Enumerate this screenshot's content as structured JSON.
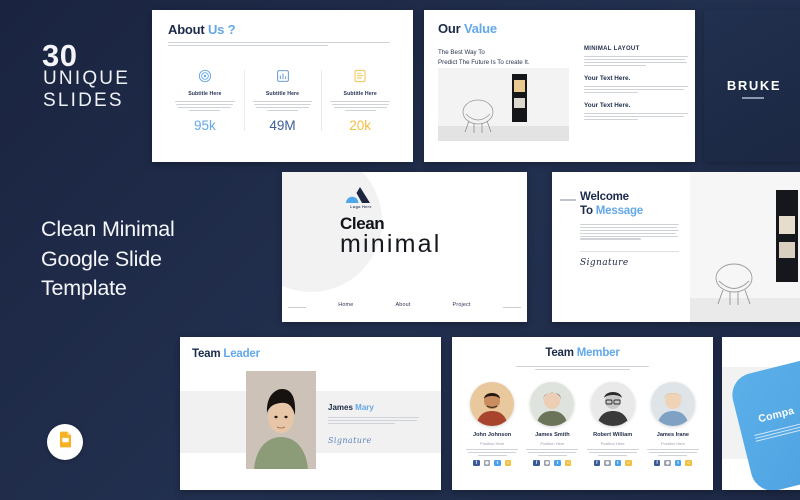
{
  "left_panel": {
    "count": "30",
    "unique": "UNIQUE",
    "slides_word": "SLIDES",
    "main_title": "Clean Minimal\nGoogle Slide\nTemplate",
    "badge_icon": "google-slides-icon"
  },
  "colors": {
    "background": "#1e2a47",
    "accent_blue": "#63a8e8",
    "accent_yellow": "#f0c040",
    "slide_white": "#ffffff",
    "band_gray": "#f1f1f1"
  },
  "slides": {
    "about": {
      "title_dark": "About",
      "title_light": "Us ?",
      "body_lines": 2,
      "columns": [
        {
          "icon": "target-icon",
          "icon_color": "#63a8e8",
          "subtitle": "Subtitle Here",
          "stat": "95k",
          "stat_color": "#63a8e8"
        },
        {
          "icon": "chart-icon",
          "icon_color": "#5a8fd0",
          "subtitle": "Subtitle Here",
          "stat": "49M",
          "stat_color": "#3c5f96"
        },
        {
          "icon": "document-icon",
          "icon_color": "#f0c040",
          "subtitle": "Subtitle Here",
          "stat": "20k",
          "stat_color": "#f0c040"
        }
      ]
    },
    "value": {
      "title_dark": "Our",
      "title_light": "Value",
      "lead_line1": "The Best Way To",
      "lead_line2": "Predict The Future Is To create It.",
      "photo": "chair-and-shelf-photo",
      "blocks": [
        {
          "heading": "MINIMAL LAYOUT",
          "body_lines": 4
        },
        {
          "heading": "Your Text Here.",
          "body_lines": 3
        },
        {
          "heading": "Your Text Here.",
          "body_lines": 3
        }
      ]
    },
    "bruke": {
      "brand": "BRUKE"
    },
    "hero": {
      "logo_icon": "mountain-cloud-logo",
      "logo_label": "Logo Here",
      "title_top": "Clean",
      "title_bottom": "minimal",
      "nav": [
        "Home",
        "About",
        "Project"
      ]
    },
    "welcome": {
      "title_line1": "Welcome",
      "title_dark": "To",
      "title_light": "Message",
      "body_lines": 6,
      "signature": "Signature",
      "photo": "chair-and-wall-shelf-photo"
    },
    "leader": {
      "title_dark": "Team",
      "title_light": "Leader",
      "photo": "portrait-man-green-sweater",
      "name_dark": "James",
      "name_light": "Mary",
      "body_lines": 3,
      "signature": "Signature"
    },
    "member": {
      "title_dark": "Team",
      "title_light": "Member",
      "body_lines": 2,
      "people": [
        {
          "name": "John Johnson",
          "position": "Position Here",
          "body_lines": 3,
          "socials": [
            "facebook-icon",
            "instagram-icon",
            "twitter-icon",
            "snapchat-icon"
          ]
        },
        {
          "name": "James Smith",
          "position": "Position Here",
          "body_lines": 3,
          "socials": [
            "facebook-icon",
            "instagram-icon",
            "twitter-icon",
            "snapchat-icon"
          ]
        },
        {
          "name": "Robert William",
          "position": "Position Here",
          "body_lines": 3,
          "socials": [
            "facebook-icon",
            "instagram-icon",
            "twitter-icon",
            "snapchat-icon"
          ]
        },
        {
          "name": "James Irane",
          "position": "Position Here",
          "body_lines": 3,
          "socials": [
            "facebook-icon",
            "instagram-icon",
            "twitter-icon",
            "snapchat-icon"
          ]
        }
      ],
      "social_colors": [
        "#3b5998",
        "#9aa0ac",
        "#49a1eb",
        "#f0c040"
      ]
    },
    "company": {
      "title": "Compa",
      "body_lines": 3
    }
  }
}
